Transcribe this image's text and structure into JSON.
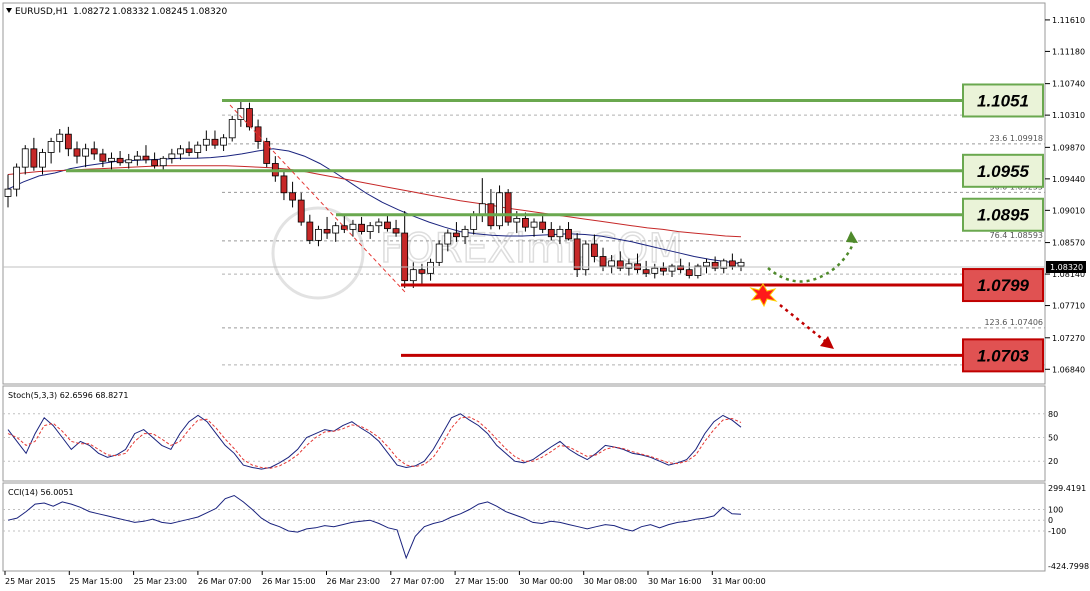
{
  "chart_data": [
    {
      "type": "candlestick",
      "header": {
        "symbol": "EURUSD,H1",
        "open": "1.08272",
        "high": "1.08332",
        "low": "1.08245",
        "close": "1.08320"
      },
      "current_price": "1.08320",
      "ylim": [
        1.0668,
        1.118
      ],
      "y_ticks": [
        "1.11610",
        "1.11180",
        "1.10740",
        "1.10310",
        "1.09870",
        "1.09440",
        "1.09010",
        "1.08570",
        "1.08140",
        "1.07710",
        "1.07270",
        "1.06840"
      ],
      "x_ticks": [
        "25 Mar 2015",
        "25 Mar 15:00",
        "25 Mar 23:00",
        "26 Mar 07:00",
        "26 Mar 15:00",
        "26 Mar 23:00",
        "27 Mar 07:00",
        "27 Mar 15:00",
        "30 Mar 00:00",
        "30 Mar 08:00",
        "30 Mar 16:00",
        "31 Mar 00:00"
      ],
      "candles": [
        [
          1.092,
          1.095,
          1.0905,
          1.093
        ],
        [
          1.093,
          1.0965,
          1.092,
          1.096
        ],
        [
          1.096,
          1.099,
          1.095,
          1.0985
        ],
        [
          1.0985,
          1.1,
          1.0955,
          1.096
        ],
        [
          1.096,
          1.0985,
          1.095,
          1.098
        ],
        [
          1.098,
          1.1,
          1.0965,
          1.0995
        ],
        [
          1.0995,
          1.1012,
          1.098,
          1.1005
        ],
        [
          1.1005,
          1.1015,
          1.0975,
          1.0985
        ],
        [
          1.0985,
          1.0995,
          1.0965,
          1.0975
        ],
        [
          1.0975,
          1.0992,
          1.096,
          1.0985
        ],
        [
          1.0985,
          1.0995,
          1.097,
          1.0978
        ],
        [
          1.0978,
          1.0985,
          1.096,
          1.0968
        ],
        [
          1.0968,
          1.098,
          1.0955,
          1.0972
        ],
        [
          1.0972,
          1.0982,
          1.0962,
          1.0966
        ],
        [
          1.0966,
          1.0978,
          1.0958,
          1.097
        ],
        [
          1.097,
          1.0982,
          1.0962,
          1.0975
        ],
        [
          1.0975,
          1.099,
          1.0965,
          1.097
        ],
        [
          1.097,
          1.098,
          1.0958,
          1.0962
        ],
        [
          1.0962,
          1.0975,
          1.0955,
          1.0972
        ],
        [
          1.0972,
          1.0985,
          1.0965,
          1.0978
        ],
        [
          1.0978,
          1.099,
          1.097,
          1.0985
        ],
        [
          1.0985,
          1.0995,
          1.0975,
          1.098
        ],
        [
          1.098,
          1.0995,
          1.0972,
          1.099
        ],
        [
          1.099,
          1.101,
          1.0982,
          1.0998
        ],
        [
          1.0998,
          1.101,
          1.0985,
          1.099
        ],
        [
          1.099,
          1.1005,
          1.0982,
          1.1
        ],
        [
          1.1,
          1.103,
          1.0995,
          1.1025
        ],
        [
          1.1025,
          1.105,
          1.1015,
          1.104
        ],
        [
          1.104,
          1.1048,
          1.101,
          1.1015
        ],
        [
          1.1015,
          1.1025,
          1.0985,
          1.0995
        ],
        [
          1.0995,
          1.1,
          1.096,
          1.0965
        ],
        [
          1.0965,
          1.0975,
          1.094,
          1.0948
        ],
        [
          1.0948,
          1.0955,
          1.0915,
          1.0925
        ],
        [
          1.0925,
          1.094,
          1.0905,
          1.0915
        ],
        [
          1.0915,
          1.0925,
          1.088,
          1.0885
        ],
        [
          1.0885,
          1.0895,
          1.0855,
          1.086
        ],
        [
          1.086,
          1.088,
          1.0852,
          1.0875
        ],
        [
          1.0875,
          1.0892,
          1.0862,
          1.087
        ],
        [
          1.087,
          1.0885,
          1.0858,
          1.088
        ],
        [
          1.088,
          1.0895,
          1.087,
          1.0875
        ],
        [
          1.0875,
          1.0888,
          1.0865,
          1.0882
        ],
        [
          1.0882,
          1.0892,
          1.0868,
          1.0872
        ],
        [
          1.0872,
          1.0885,
          1.0862,
          1.088
        ],
        [
          1.088,
          1.089,
          1.087,
          1.0885
        ],
        [
          1.0885,
          1.0895,
          1.0872,
          1.0876
        ],
        [
          1.0876,
          1.0888,
          1.0865,
          1.087
        ],
        [
          1.087,
          1.09,
          1.0795,
          1.0805
        ],
        [
          1.0805,
          1.083,
          1.0795,
          1.082
        ],
        [
          1.082,
          1.0828,
          1.08,
          1.0815
        ],
        [
          1.0815,
          1.0835,
          1.0805,
          1.083
        ],
        [
          1.083,
          1.086,
          1.0825,
          1.0855
        ],
        [
          1.0855,
          1.0875,
          1.0845,
          1.087
        ],
        [
          1.087,
          1.0885,
          1.0858,
          1.0865
        ],
        [
          1.0865,
          1.088,
          1.0855,
          1.0875
        ],
        [
          1.0875,
          1.09,
          1.0868,
          1.0895
        ],
        [
          1.0895,
          1.0945,
          1.0885,
          1.091
        ],
        [
          1.091,
          1.093,
          1.0875,
          1.088
        ],
        [
          1.088,
          1.0935,
          1.0875,
          1.0925
        ],
        [
          1.0925,
          1.093,
          1.088,
          1.0885
        ],
        [
          1.0885,
          1.09,
          1.087,
          1.089
        ],
        [
          1.089,
          1.0898,
          1.0872,
          1.0878
        ],
        [
          1.0878,
          1.089,
          1.0865,
          1.0885
        ],
        [
          1.0885,
          1.0895,
          1.087,
          1.0875
        ],
        [
          1.0875,
          1.0885,
          1.086,
          1.0865
        ],
        [
          1.0865,
          1.088,
          1.0855,
          1.0875
        ],
        [
          1.0875,
          1.0885,
          1.086,
          1.0862
        ],
        [
          1.0862,
          1.087,
          1.081,
          1.082
        ],
        [
          1.082,
          1.086,
          1.0812,
          1.0855
        ],
        [
          1.0855,
          1.0868,
          1.083,
          1.0838
        ],
        [
          1.0838,
          1.085,
          1.0818,
          1.0825
        ],
        [
          1.0825,
          1.084,
          1.0815,
          1.0832
        ],
        [
          1.0832,
          1.0845,
          1.0818,
          1.0822
        ],
        [
          1.0822,
          1.0835,
          1.0812,
          1.0828
        ],
        [
          1.0828,
          1.0842,
          1.0815,
          1.082
        ],
        [
          1.082,
          1.0832,
          1.081,
          1.0815
        ],
        [
          1.0815,
          1.0828,
          1.0808,
          1.0822
        ],
        [
          1.0822,
          1.083,
          1.0812,
          1.0818
        ],
        [
          1.0818,
          1.0828,
          1.081,
          1.0825
        ],
        [
          1.0825,
          1.0835,
          1.0815,
          1.082
        ],
        [
          1.082,
          1.083,
          1.0808,
          1.0812
        ],
        [
          1.0812,
          1.0828,
          1.0808,
          1.0825
        ],
        [
          1.0825,
          1.0835,
          1.0815,
          1.083
        ],
        [
          1.083,
          1.0838,
          1.0818,
          1.0822
        ],
        [
          1.0822,
          1.0835,
          1.0815,
          1.0832
        ],
        [
          1.0832,
          1.0842,
          1.082,
          1.0825
        ],
        [
          1.0825,
          1.0835,
          1.0818,
          1.083
        ]
      ],
      "moving_averages": [
        {
          "color": "#1a237e",
          "values": [
            1.093,
            1.094,
            1.0948,
            1.0952,
            1.0958,
            1.0962,
            1.0965,
            1.0968,
            1.0969,
            1.097,
            1.0971,
            1.0972,
            1.0972,
            1.0973,
            1.0975,
            1.0978,
            1.0982,
            1.0985,
            1.0982,
            1.0975,
            1.0965,
            1.0952,
            1.0938,
            1.0924,
            1.0912,
            1.0902,
            1.0893,
            1.0885,
            1.0878,
            1.0872,
            1.0869,
            1.0867,
            1.0866,
            1.0866,
            1.0867,
            1.0868,
            1.0869,
            1.0868,
            1.0866,
            1.0862,
            1.0858,
            1.0853,
            1.0848,
            1.0843,
            1.0838,
            1.0834,
            1.0831,
            1.0828
          ]
        },
        {
          "color": "#c62828",
          "values": [
            1.095,
            1.0952,
            1.0954,
            1.0955,
            1.0956,
            1.0957,
            1.0958,
            1.0959,
            1.096,
            1.0961,
            1.0962,
            1.0962,
            1.0962,
            1.0962,
            1.0962,
            1.0961,
            1.096,
            1.0959,
            1.0957,
            1.0954,
            1.095,
            1.0946,
            1.0942,
            1.0938,
            1.0934,
            1.093,
            1.0926,
            1.0922,
            1.0918,
            1.0914,
            1.0911,
            1.0908,
            1.0904,
            1.0901,
            1.0898,
            1.0895,
            1.0892,
            1.0889,
            1.0886,
            1.0883,
            1.088,
            1.0877,
            1.0875,
            1.0872,
            1.087,
            1.0868,
            1.0866,
            1.0865
          ]
        }
      ],
      "levels": [
        {
          "label": "1.1051",
          "value": 1.1051,
          "kind": "resistance",
          "color": "#6aa84f",
          "fill": "#eaf3d8"
        },
        {
          "label": "1.0955",
          "value": 1.0955,
          "kind": "resistance",
          "color": "#6aa84f",
          "fill": "#eaf3d8"
        },
        {
          "label": "1.0895",
          "value": 1.0895,
          "kind": "resistance",
          "color": "#6aa84f",
          "fill": "#eaf3d8"
        },
        {
          "label": "1.0799",
          "value": 1.0799,
          "kind": "support",
          "color": "#c00000",
          "fill": "#e05252"
        },
        {
          "label": "1.0703",
          "value": 1.0703,
          "kind": "support",
          "color": "#c00000",
          "fill": "#e05252"
        }
      ],
      "fib_levels": [
        {
          "label": "23.6 1.09918",
          "value": 1.09918
        },
        {
          "label": "50.0 1.09255",
          "value": 1.09255
        },
        {
          "label": "76.4 1.08593",
          "value": 1.08593
        },
        {
          "label": "123.6 1.07406",
          "value": 1.07406
        }
      ],
      "watermark": "FOREXimf.COM"
    },
    {
      "type": "line",
      "title": "Stoch(5,3,3) 62.6596 68.8271",
      "ylim": [
        0,
        100
      ],
      "y_ticks": [
        "80",
        "50",
        "20"
      ],
      "series": [
        {
          "color": "#1a237e",
          "values": [
            60,
            45,
            30,
            55,
            75,
            65,
            50,
            35,
            45,
            40,
            30,
            25,
            28,
            35,
            55,
            60,
            50,
            40,
            35,
            55,
            70,
            78,
            70,
            55,
            40,
            30,
            15,
            12,
            10,
            12,
            18,
            25,
            35,
            50,
            55,
            60,
            58,
            65,
            70,
            62,
            55,
            45,
            30,
            15,
            12,
            14,
            20,
            35,
            55,
            75,
            80,
            72,
            65,
            55,
            40,
            30,
            20,
            18,
            22,
            30,
            38,
            45,
            35,
            28,
            22,
            30,
            40,
            38,
            35,
            30,
            28,
            25,
            20,
            15,
            18,
            22,
            35,
            55,
            70,
            78,
            72,
            63
          ]
        },
        {
          "color": "#e53935",
          "dashed": true,
          "values": [
            55,
            50,
            40,
            45,
            65,
            68,
            58,
            45,
            42,
            42,
            35,
            28,
            27,
            30,
            45,
            55,
            55,
            48,
            40,
            45,
            60,
            72,
            73,
            62,
            48,
            36,
            22,
            15,
            12,
            11,
            14,
            20,
            28,
            40,
            50,
            57,
            58,
            61,
            66,
            64,
            58,
            50,
            38,
            24,
            15,
            13,
            16,
            25,
            42,
            62,
            75,
            76,
            70,
            60,
            48,
            36,
            26,
            20,
            20,
            25,
            32,
            40,
            38,
            32,
            26,
            28,
            35,
            38,
            36,
            32,
            29,
            26,
            22,
            18,
            17,
            20,
            28,
            45,
            60,
            72,
            74,
            69
          ]
        }
      ]
    },
    {
      "type": "line",
      "title": "CCI(14) 56.0051",
      "ylim": [
        -424.7998,
        299.4191
      ],
      "y_ticks": [
        "299.4191",
        "100",
        "0",
        "-100",
        "-424.7998"
      ],
      "series": [
        {
          "color": "#1a237e",
          "values": [
            0,
            20,
            80,
            150,
            160,
            130,
            170,
            150,
            120,
            80,
            60,
            40,
            20,
            0,
            -20,
            -10,
            10,
            -20,
            -30,
            -10,
            10,
            30,
            70,
            110,
            200,
            230,
            170,
            100,
            20,
            -30,
            -60,
            -100,
            -110,
            -80,
            -70,
            -50,
            -60,
            -40,
            -20,
            -10,
            0,
            -30,
            -70,
            -90,
            -350,
            -150,
            -60,
            -30,
            -10,
            30,
            60,
            100,
            150,
            170,
            130,
            80,
            50,
            20,
            -20,
            -30,
            -10,
            -20,
            -40,
            -60,
            -80,
            -60,
            -40,
            -50,
            -80,
            -100,
            -60,
            -40,
            -70,
            -40,
            -20,
            -10,
            10,
            20,
            40,
            120,
            60,
            56
          ]
        }
      ]
    }
  ]
}
